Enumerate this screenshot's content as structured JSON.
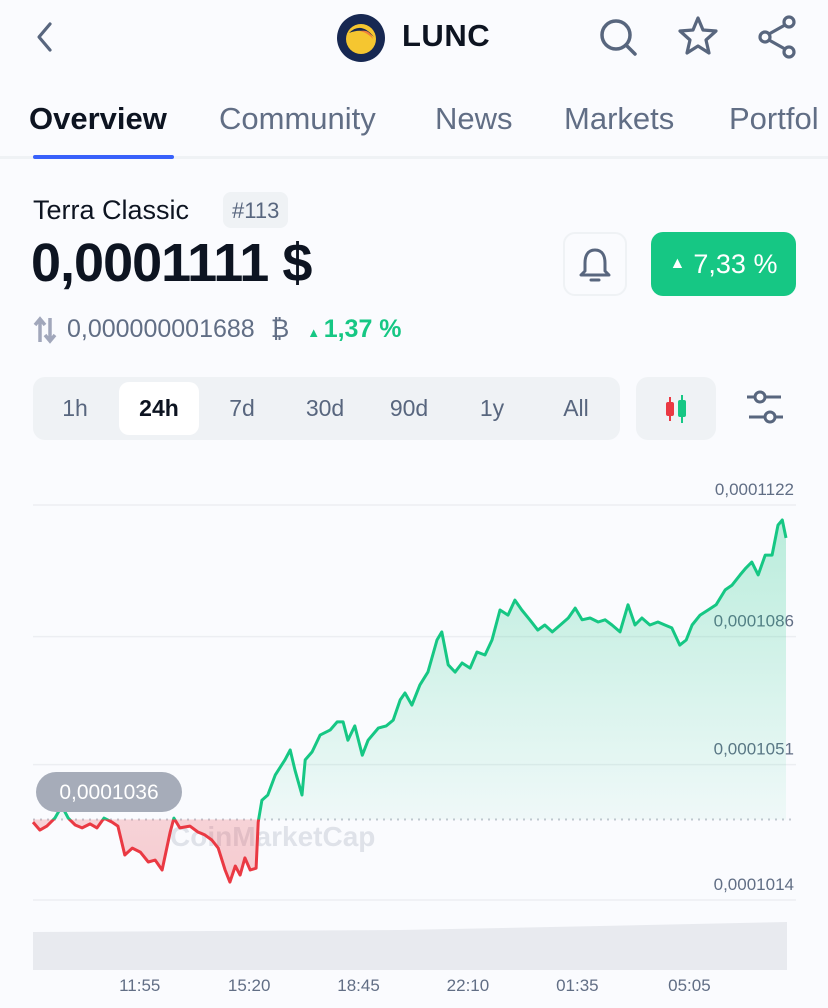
{
  "header": {
    "title": "LUNC",
    "back_icon": "chevron-left-icon",
    "logo_icon": "terra-classic-logo",
    "icons": [
      "search-icon",
      "star-icon",
      "share-icon"
    ]
  },
  "tabs": [
    {
      "label": "Overview",
      "active": true
    },
    {
      "label": "Community"
    },
    {
      "label": "News"
    },
    {
      "label": "Markets"
    },
    {
      "label": "Portfol"
    }
  ],
  "coin": {
    "name": "Terra Classic",
    "rank": "#113",
    "price": "0,0001111 $",
    "change_24h": "7,33 %",
    "btc_price": "0,000000001688",
    "btc_symbol": "₿",
    "btc_change": "1,37 %"
  },
  "colors": {
    "accent": "#3861fb",
    "up": "#16c784",
    "down": "#ea3943"
  },
  "time_ranges": [
    {
      "label": "1h"
    },
    {
      "label": "24h",
      "active": true
    },
    {
      "label": "7d"
    },
    {
      "label": "30d"
    },
    {
      "label": "90d"
    },
    {
      "label": "1y"
    },
    {
      "label": "All"
    }
  ],
  "chart_data": {
    "type": "line",
    "watermark": "CoinMarketCap",
    "baseline": {
      "value": 0.0001036,
      "label": "0,0001036"
    },
    "y_ticks": [
      {
        "value": 0.0001122,
        "label": "0,0001122"
      },
      {
        "value": 0.0001086,
        "label": "0,0001086"
      },
      {
        "value": 0.0001051,
        "label": "0,0001051"
      },
      {
        "value": 0.0001014,
        "label": "0,0001014"
      }
    ],
    "x_ticks": [
      "11:55",
      "15:20",
      "18:45",
      "22:10",
      "01:35",
      "05:05"
    ],
    "grid": true,
    "volume_shown": true,
    "points": [
      [
        "08:35",
        0.00010353
      ],
      [
        "08:48",
        0.00010331
      ],
      [
        "09:01",
        0.00010342
      ],
      [
        "09:16",
        0.00010364
      ],
      [
        "09:29",
        0.00010397
      ],
      [
        "09:41",
        0.00010364
      ],
      [
        "09:54",
        0.00010345
      ],
      [
        "10:07",
        0.00010337
      ],
      [
        "10:22",
        0.00010348
      ],
      [
        "10:35",
        0.00010337
      ],
      [
        "10:48",
        0.00010364
      ],
      [
        "11:03",
        0.00010353
      ],
      [
        "11:14",
        0.00010342
      ],
      [
        "11:27",
        0.00010263
      ],
      [
        "11:41",
        0.00010282
      ],
      [
        "11:56",
        0.00010271
      ],
      [
        "12:11",
        0.00010244
      ],
      [
        "12:24",
        0.00010249
      ],
      [
        "12:37",
        0.00010222
      ],
      [
        "12:52",
        0.00010326
      ],
      [
        "12:59",
        0.00010364
      ],
      [
        "13:10",
        0.00010337
      ],
      [
        "13:29",
        0.00010342
      ],
      [
        "13:44",
        0.00010326
      ],
      [
        "13:57",
        0.00010318
      ],
      [
        "14:10",
        0.00010304
      ],
      [
        "14:22",
        0.00010282
      ],
      [
        "14:35",
        0.00010222
      ],
      [
        "14:44",
        0.00010189
      ],
      [
        "14:54",
        0.00010233
      ],
      [
        "15:03",
        0.00010208
      ],
      [
        "15:12",
        0.00010255
      ],
      [
        "15:22",
        0.00010222
      ],
      [
        "15:33",
        0.00010227
      ],
      [
        "15:37",
        0.00010353
      ],
      [
        "15:44",
        0.00010413
      ],
      [
        "15:55",
        0.00010427
      ],
      [
        "16:09",
        0.00010482
      ],
      [
        "16:27",
        0.00010523
      ],
      [
        "16:37",
        0.0001055
      ],
      [
        "16:46",
        0.00010495
      ],
      [
        "16:59",
        0.00010427
      ],
      [
        "17:05",
        0.00010523
      ],
      [
        "17:18",
        0.00010545
      ],
      [
        "17:33",
        0.00010591
      ],
      [
        "17:52",
        0.00010605
      ],
      [
        "18:05",
        0.00010627
      ],
      [
        "18:16",
        0.00010627
      ],
      [
        "18:25",
        0.00010577
      ],
      [
        "18:38",
        0.00010616
      ],
      [
        "18:52",
        0.00010536
      ],
      [
        "19:03",
        0.00010577
      ],
      [
        "19:22",
        0.0001061
      ],
      [
        "19:37",
        0.00010616
      ],
      [
        "19:50",
        0.00010632
      ],
      [
        "20:03",
        0.00010687
      ],
      [
        "20:12",
        0.00010706
      ],
      [
        "20:25",
        0.00010673
      ],
      [
        "20:40",
        0.00010728
      ],
      [
        "20:55",
        0.00010763
      ],
      [
        "21:12",
        0.00010851
      ],
      [
        "21:21",
        0.00010873
      ],
      [
        "21:33",
        0.00010783
      ],
      [
        "21:46",
        0.00010763
      ],
      [
        "21:59",
        0.00010788
      ],
      [
        "22:14",
        0.00010774
      ],
      [
        "22:27",
        0.00010818
      ],
      [
        "22:42",
        0.0001081
      ],
      [
        "22:55",
        0.00010851
      ],
      [
        "23:10",
        0.00010933
      ],
      [
        "23:25",
        0.00010919
      ],
      [
        "23:38",
        0.0001096
      ],
      [
        "23:51",
        0.00010933
      ],
      [
        "00:06",
        0.00010906
      ],
      [
        "00:21",
        0.00010878
      ],
      [
        "00:34",
        0.00010892
      ],
      [
        "00:48",
        0.00010873
      ],
      [
        "01:03",
        0.00010892
      ],
      [
        "01:18",
        0.00010911
      ],
      [
        "01:31",
        0.00010938
      ],
      [
        "01:44",
        0.00010906
      ],
      [
        "01:59",
        0.00010911
      ],
      [
        "02:14",
        0.000109
      ],
      [
        "02:27",
        0.00010906
      ],
      [
        "02:40",
        0.00010892
      ],
      [
        "02:55",
        0.00010873
      ],
      [
        "03:10",
        0.00010947
      ],
      [
        "03:23",
        0.00010892
      ],
      [
        "03:36",
        0.00010911
      ],
      [
        "03:51",
        0.00010892
      ],
      [
        "04:06",
        0.000109
      ],
      [
        "04:19",
        0.00010892
      ],
      [
        "04:32",
        0.00010884
      ],
      [
        "04:47",
        0.00010837
      ],
      [
        "04:59",
        0.00010851
      ],
      [
        "05:10",
        0.00010892
      ],
      [
        "05:25",
        0.00010919
      ],
      [
        "05:40",
        0.00010933
      ],
      [
        "05:55",
        0.00010947
      ],
      [
        "06:12",
        0.00010988
      ],
      [
        "06:25",
        0.00011001
      ],
      [
        "06:40",
        0.00011029
      ],
      [
        "06:51",
        0.00011048
      ],
      [
        "07:02",
        0.00011064
      ],
      [
        "07:14",
        0.00011029
      ],
      [
        "07:27",
        0.00011083
      ],
      [
        "07:40",
        0.00011083
      ],
      [
        "07:51",
        0.00011165
      ],
      [
        "07:59",
        0.00011179
      ],
      [
        "08:06",
        0.0001113
      ]
    ]
  }
}
